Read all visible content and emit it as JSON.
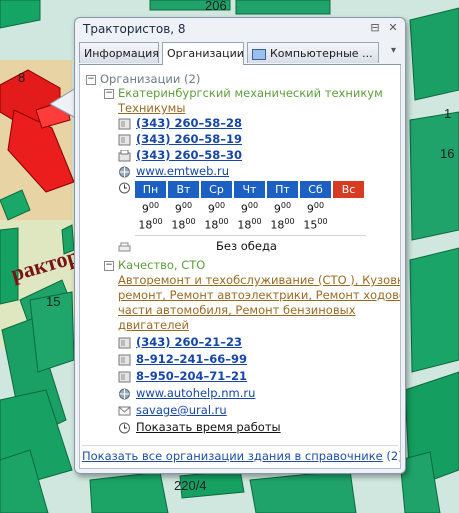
{
  "map": {
    "labels": {
      "top": "206",
      "building_8": "8",
      "right_a": "1",
      "right_b": "16",
      "street": "рактор",
      "building_15": "15",
      "bottom": "220/4"
    }
  },
  "popup": {
    "title": "Трактористов, 8",
    "pin_icon": "pin-icon",
    "close_icon": "close-icon",
    "tabs": [
      {
        "label": "Информация",
        "active": false
      },
      {
        "label": "Организации",
        "active": true
      },
      {
        "label": "Компьютерные ...",
        "active": false
      }
    ],
    "tab_scroll_glyph": "▾",
    "orgs": {
      "header": "Организации (2)",
      "toggle": "−",
      "items": [
        {
          "name": "Екатеринбургский механический техникум",
          "categories": [
            "Техникумы"
          ],
          "phones": [
            {
              "icon": "phone-icon",
              "number": "(343) 260–58–28"
            },
            {
              "icon": "phone-icon",
              "number": "(343) 260–58–19"
            },
            {
              "icon": "fax-icon",
              "number": "(343) 260–58–30"
            }
          ],
          "website": "www.emtweb.ru",
          "schedule": {
            "days": [
              "Пн",
              "Вт",
              "Ср",
              "Чт",
              "Пт",
              "Сб",
              "Вс"
            ],
            "open": [
              {
                "h": "9",
                "m": "00"
              },
              {
                "h": "9",
                "m": "00"
              },
              {
                "h": "9",
                "m": "00"
              },
              {
                "h": "9",
                "m": "00"
              },
              {
                "h": "9",
                "m": "00"
              },
              {
                "h": "9",
                "m": "00"
              },
              {
                "h": "",
                "m": ""
              }
            ],
            "close": [
              {
                "h": "18",
                "m": "00"
              },
              {
                "h": "18",
                "m": "00"
              },
              {
                "h": "18",
                "m": "00"
              },
              {
                "h": "18",
                "m": "00"
              },
              {
                "h": "18",
                "m": "00"
              },
              {
                "h": "15",
                "m": "00"
              },
              {
                "h": "",
                "m": ""
              }
            ],
            "lunch": "Без обеда"
          }
        },
        {
          "name": "Качество, СТО",
          "categories_text": [
            "Авторемонт и техобслуживание (СТО ), Кузовной",
            "ремонт, Ремонт автоэлектрики, Ремонт ходовой",
            "части автомобиля, Ремонт бензиновых",
            "двигателей"
          ],
          "phones": [
            {
              "icon": "phone-icon",
              "number": "(343) 260–21–23"
            },
            {
              "icon": "phone-icon",
              "number": "8–912–241–66–99"
            },
            {
              "icon": "phone-icon",
              "number": "8–950–204–71–21"
            }
          ],
          "website": "www.autohelp.nm.ru",
          "email": "savage@ural.ru",
          "show_hours": "Показать время работы"
        }
      ]
    },
    "footer_link": "Показать все организации здания в справочнике",
    "footer_count": "(2)"
  },
  "colors": {
    "map_bg": "#cfe7df",
    "building_green": "#1fa36a",
    "building_red": "#e31b1b",
    "day_blue": "#1b60c2",
    "day_red": "#d73c22"
  }
}
